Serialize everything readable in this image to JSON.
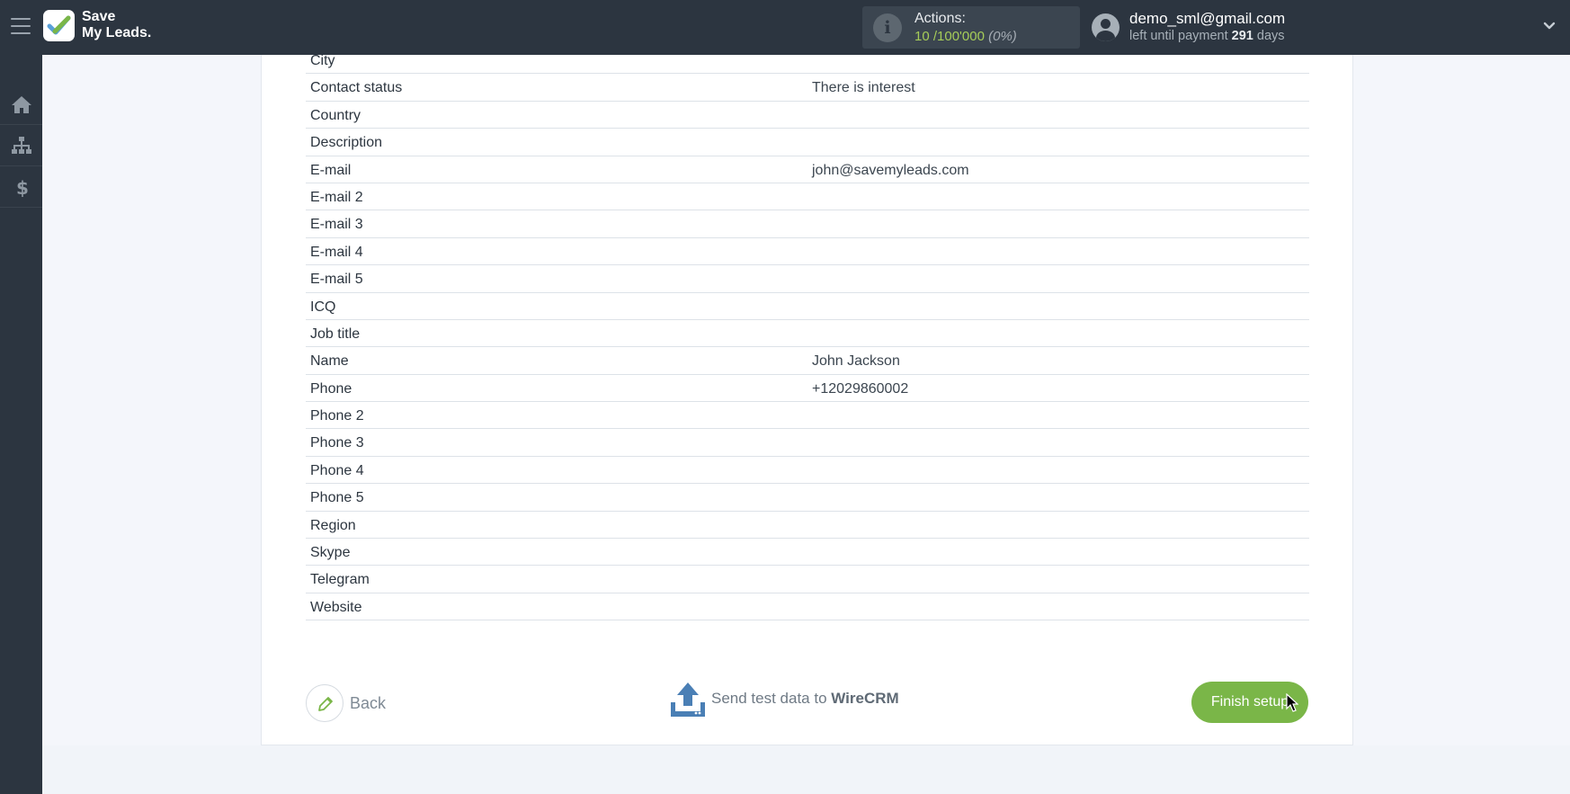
{
  "topbar": {
    "logo_line1": "Save",
    "logo_line2": "My Leads.",
    "actions": {
      "label": "Actions:",
      "used": "10",
      "separator": " /",
      "limit": "100'000",
      "percent": "(0%)"
    },
    "user": {
      "email": "demo_sml@gmail.com",
      "payment_prefix": "left until payment ",
      "payment_days": "291",
      "payment_suffix": " days"
    }
  },
  "sidebar": {
    "items": [
      {
        "icon": "home-icon"
      },
      {
        "icon": "sitemap-icon"
      },
      {
        "icon": "dollar-icon"
      }
    ]
  },
  "fields": [
    {
      "label": "City",
      "value": ""
    },
    {
      "label": "Contact status",
      "value": "There is interest"
    },
    {
      "label": "Country",
      "value": ""
    },
    {
      "label": "Description",
      "value": ""
    },
    {
      "label": "E-mail",
      "value": "john@savemyleads.com"
    },
    {
      "label": "E-mail 2",
      "value": ""
    },
    {
      "label": "E-mail 3",
      "value": ""
    },
    {
      "label": "E-mail 4",
      "value": ""
    },
    {
      "label": "E-mail 5",
      "value": ""
    },
    {
      "label": "ICQ",
      "value": ""
    },
    {
      "label": "Job title",
      "value": ""
    },
    {
      "label": "Name",
      "value": "John Jackson"
    },
    {
      "label": "Phone",
      "value": "+12029860002"
    },
    {
      "label": "Phone 2",
      "value": ""
    },
    {
      "label": "Phone 3",
      "value": ""
    },
    {
      "label": "Phone 4",
      "value": ""
    },
    {
      "label": "Phone 5",
      "value": ""
    },
    {
      "label": "Region",
      "value": ""
    },
    {
      "label": "Skype",
      "value": ""
    },
    {
      "label": "Telegram",
      "value": ""
    },
    {
      "label": "Website",
      "value": ""
    }
  ],
  "footer": {
    "back_label": "Back",
    "send_prefix": "Send test data to ",
    "send_target": "WireCRM",
    "finish_label": "Finish setup"
  },
  "colors": {
    "topbar": "#2c3540",
    "accent_green": "#7ab648",
    "send_icon_blue": "#4a7fb5"
  }
}
